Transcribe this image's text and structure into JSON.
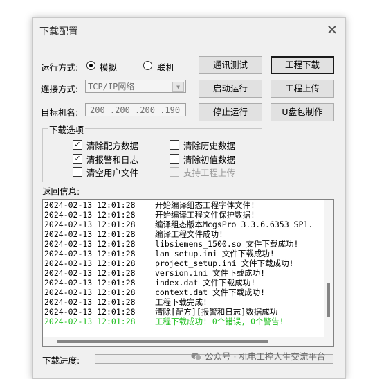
{
  "window": {
    "title": "下载配置",
    "close_glyph": "✕"
  },
  "run_mode": {
    "label": "运行方式:",
    "options": [
      "模拟",
      "联机"
    ],
    "selected": "模拟"
  },
  "connection": {
    "label": "连接方式:",
    "value": "TCP/IP网络"
  },
  "target": {
    "label": "目标机名:",
    "value": "200 .200 .200 .190"
  },
  "buttons": {
    "comm_test": "通讯测试",
    "project_download": "工程下载",
    "start_run": "启动运行",
    "project_upload": "工程上传",
    "stop_run": "停止运行",
    "usb_make": "U盘包制作"
  },
  "download_options": {
    "title": "下载选项",
    "items": [
      {
        "label": "清除配方数据",
        "checked": true,
        "enabled": true
      },
      {
        "label": "清除历史数据",
        "checked": false,
        "enabled": true
      },
      {
        "label": "清报警和日志",
        "checked": true,
        "enabled": true
      },
      {
        "label": "清除初值数据",
        "checked": false,
        "enabled": true
      },
      {
        "label": "清空用户文件",
        "checked": false,
        "enabled": true
      },
      {
        "label": "支持工程上传",
        "checked": false,
        "enabled": false
      }
    ]
  },
  "log": {
    "label": "返回信息:",
    "success_color": "#22c022",
    "lines": [
      {
        "time": "2024-02-13 12:01:28",
        "msg": "开始编译组态工程字体文件!",
        "success": false
      },
      {
        "time": "2024-02-13 12:01:28",
        "msg": "开始编译工程文件保护数据!",
        "success": false
      },
      {
        "time": "2024-02-13 12:01:28",
        "msg": "编译组态版本McgsPro 3.3.6.6353 SP1.",
        "success": false
      },
      {
        "time": "2024-02-13 12:01:28",
        "msg": "编译工程文件成功!",
        "success": false
      },
      {
        "time": "2024-02-13 12:01:28",
        "msg": "libsiemens_1500.so 文件下载成功!",
        "success": false
      },
      {
        "time": "2024-02-13 12:01:28",
        "msg": "lan_setup.ini 文件下载成功!",
        "success": false
      },
      {
        "time": "2024-02-13 12:01:28",
        "msg": "project_setup.ini 文件下载成功!",
        "success": false
      },
      {
        "time": "2024-02-13 12:01:28",
        "msg": "version.ini 文件下载成功!",
        "success": false
      },
      {
        "time": "2024-02-13 12:01:28",
        "msg": "index.dat 文件下载成功!",
        "success": false
      },
      {
        "time": "2024-02-13 12:01:28",
        "msg": "context.dat 文件下载成功!",
        "success": false
      },
      {
        "time": "2024-02-13 12:01:28",
        "msg": "工程下载完成!",
        "success": false
      },
      {
        "time": "2024-02-13 12:01:28",
        "msg": "清除[配方][报警和日志]数据成功",
        "success": false
      },
      {
        "time": "2024-02-13 12:01:28",
        "msg": "工程下载成功! 0个错误, 0个警告!",
        "success": true
      }
    ]
  },
  "progress": {
    "label": "下载进度:",
    "fraction": 0
  },
  "watermark": {
    "icon": "wechat-icon",
    "text": "公众号 · 机电工控人生交流平台"
  }
}
